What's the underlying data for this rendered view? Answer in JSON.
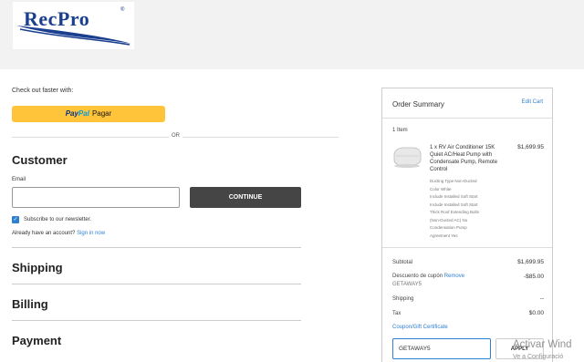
{
  "brand": {
    "logo_text": "RecPro",
    "logo_reg": "®",
    "brand_color": "#1b3f8f"
  },
  "checkout": {
    "express_label": "Check out faster with:",
    "paypal": {
      "brand_pay": "Pay",
      "brand_pal": "Pal",
      "action": "Pagar"
    },
    "or_text": "OR"
  },
  "customer": {
    "title": "Customer",
    "email_label": "Email",
    "email_value": "",
    "continue_label": "CONTINUE",
    "subscribe_label": "Subscribe to our newsletter.",
    "subscribe_checked": true,
    "account_prompt": "Already have an account?",
    "signin_label": "Sign in now"
  },
  "steps": [
    {
      "title": "Shipping"
    },
    {
      "title": "Billing"
    },
    {
      "title": "Payment"
    }
  ],
  "order_summary": {
    "title": "Order Summary",
    "edit_cart_label": "Edit Cart",
    "item_count": "1 Item",
    "product": {
      "name": "1 x RV Air Conditioner 15K Quiet AC/Heat Pump with Condensate Pump, Remote Control",
      "price": "$1,699.95",
      "options": [
        "Ducting Type Non-Ducted",
        "Color White",
        "Include Installed Soft Start",
        "Include Installed Soft Start",
        "Thick Roof Extending Bolts",
        "(Non-Ducted AC) No",
        "Condensation Pump",
        "Agreement Yes"
      ]
    },
    "subtotal_label": "Subtotal",
    "subtotal_value": "$1,699.95",
    "coupon_label": "Descuento de cupón",
    "coupon_remove": "Remove",
    "coupon_code": "GETAWAY5",
    "coupon_value": "-$85.00",
    "shipping_label": "Shipping",
    "shipping_value": "--",
    "tax_label": "Tax",
    "tax_value": "$0.00",
    "coupon_gift_label": "Coupon/Gift Certificate",
    "coupon_input_value": "GETAWAY5",
    "apply_label": "APPLY"
  },
  "watermark": {
    "line1": "Activar Wind",
    "line2": "Ve a Configuració"
  },
  "colors": {
    "accent": "#2d7fd1",
    "paypal_yellow": "#ffc439",
    "button_dark": "#454545"
  }
}
